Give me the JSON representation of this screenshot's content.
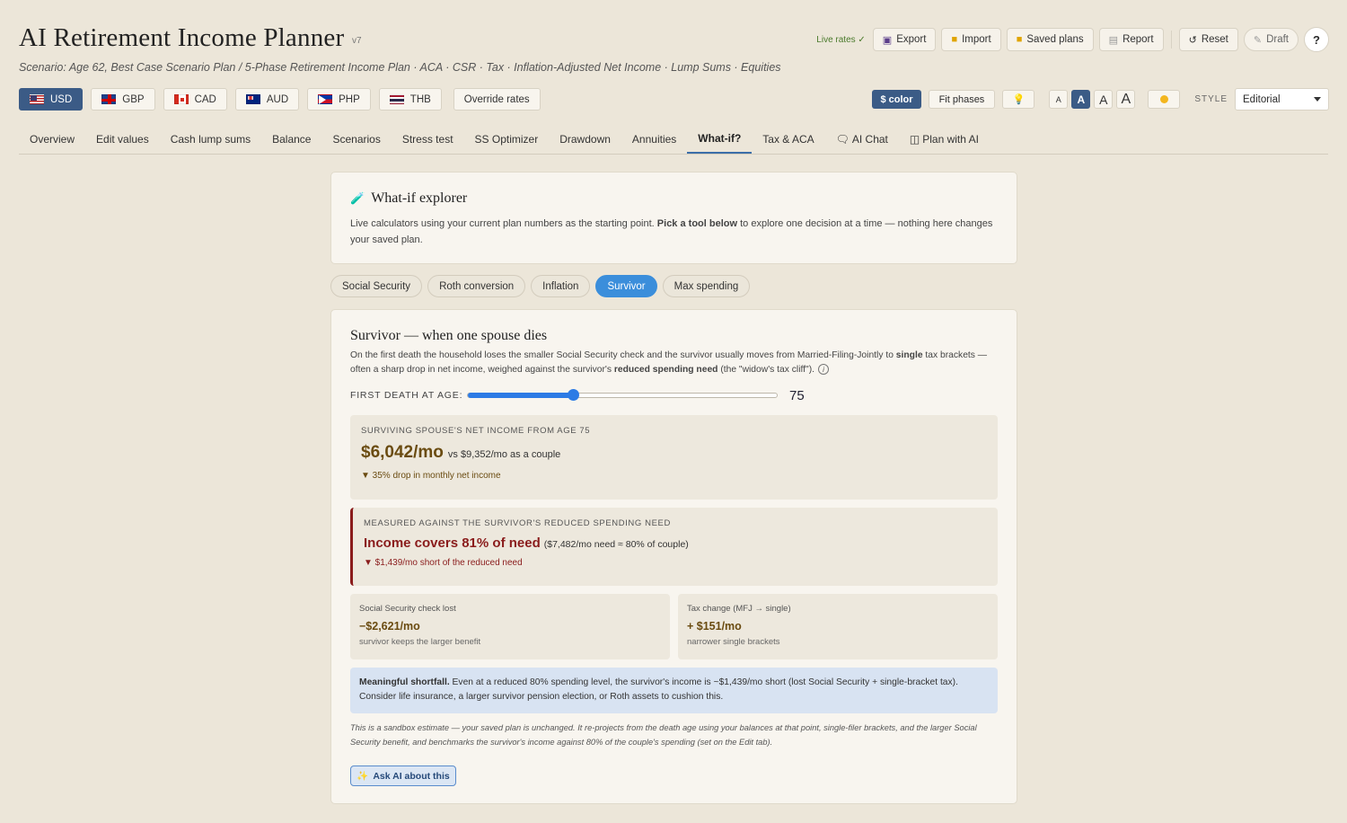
{
  "header": {
    "title": "AI Retirement Income Planner",
    "version": "v7",
    "subtitle": "Scenario: Age 62, Best Case Scenario Plan / 5-Phase Retirement Income Plan · ACA · CSR · Tax · Inflation-Adjusted Net Income · Lump Sums · Equities",
    "live_rates": "Live rates ✓",
    "buttons": {
      "export": "Export",
      "import": "Import",
      "saved_plans": "Saved plans",
      "report": "Report",
      "reset": "Reset",
      "draft": "Draft",
      "help": "?"
    }
  },
  "currencies": [
    {
      "code": "USD",
      "icon": "us-flag-icon",
      "active": true
    },
    {
      "code": "GBP",
      "icon": "gb-flag-icon"
    },
    {
      "code": "CAD",
      "icon": "ca-flag-icon"
    },
    {
      "code": "AUD",
      "icon": "au-flag-icon"
    },
    {
      "code": "PHP",
      "icon": "ph-flag-icon"
    },
    {
      "code": "THB",
      "icon": "th-flag-icon"
    }
  ],
  "override_rates": "Override rates",
  "controls": {
    "dollar_color": "$ color",
    "fit_phases": "Fit phases",
    "font_sizes": [
      "A",
      "A",
      "A",
      "A"
    ],
    "style_label": "STYLE",
    "style_value": "Editorial"
  },
  "nav": {
    "tabs": [
      "Overview",
      "Edit values",
      "Cash lump sums",
      "Balance",
      "Scenarios",
      "Stress test",
      "SS Optimizer",
      "Drawdown",
      "Annuities",
      "What-if?",
      "Tax & ACA",
      "AI Chat",
      "Plan with AI"
    ],
    "active": "What-if?"
  },
  "explorer": {
    "title": "What-if explorer",
    "desc_a": "Live calculators using your current plan numbers as the starting point. ",
    "desc_b": "Pick a tool below",
    "desc_c": " to explore one decision at a time — nothing here changes your saved plan."
  },
  "tools": {
    "items": [
      "Social Security",
      "Roth conversion",
      "Inflation",
      "Survivor",
      "Max spending"
    ],
    "active": "Survivor"
  },
  "survivor": {
    "title": "Survivor — when one spouse dies",
    "desc_a": "On the first death the household loses the smaller Social Security check and the survivor usually moves from Married-Filing-Jointly to ",
    "desc_b": "single",
    "desc_c": " tax brackets — often a sharp drop in net income, weighed against the survivor's ",
    "desc_d": "reduced spending need",
    "desc_e": " (the \"widow's tax cliff\").",
    "slider_label": "FIRST DEATH AT AGE:",
    "slider_value": "75",
    "slider_fraction": 0.34,
    "net_income_caption": "SURVIVING SPOUSE'S NET INCOME FROM AGE 75",
    "net_income": "$6,042/mo",
    "vs_couple": "vs $9,352/mo as a couple",
    "drop": "▼ 35% drop in monthly net income",
    "measured_caption": "MEASURED AGAINST THE SURVIVOR'S REDUCED SPENDING NEED",
    "covers": "Income covers 81% of need",
    "covers_sub": "($7,482/mo need ≈ 80% of couple)",
    "shortfall": "▼ $1,439/mo short of the reduced need",
    "ss_lost_title": "Social Security check lost",
    "ss_lost_value": "−$2,621/mo",
    "ss_lost_sub": "survivor keeps the larger benefit",
    "tax_title": "Tax change (MFJ → single)",
    "tax_value": "+ $151/mo",
    "tax_sub": "narrower single brackets",
    "alert_bold": "Meaningful shortfall.",
    "alert_text": " Even at a reduced 80% spending level, the survivor's income is ~$1,439/mo short (lost Social Security + single-bracket tax). Consider life insurance, a larger survivor pension election, or Roth assets to cushion this.",
    "note": "This is a sandbox estimate — your saved plan is unchanged. It re-projects from the death age using your balances at that point, single-filer brackets, and the larger Social Security benefit, and benchmarks the survivor's income against 80% of the couple's spending (set on the Edit tab).",
    "ask_ai": "Ask AI about this"
  },
  "colors": {
    "accent": "#3b5b86",
    "tab_blue": "#3b8edb",
    "warning_brown": "#6a4b10",
    "danger_red": "#8a1c1c",
    "alert_bg": "#d8e3f2"
  }
}
